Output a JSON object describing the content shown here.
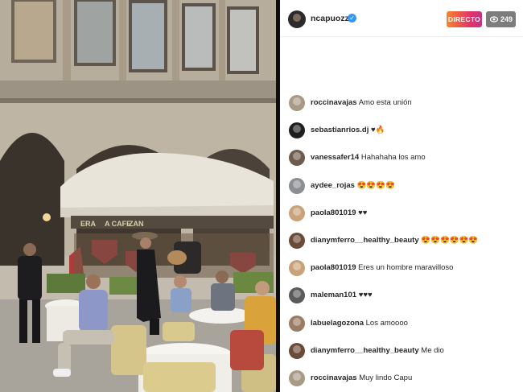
{
  "live": {
    "host": "ncapuozzo",
    "verified": true,
    "live_label": "DIRECTO",
    "viewer_icon": "eye-icon",
    "viewer_count": "249"
  },
  "comments": [
    {
      "user": "roccinavajas",
      "text": "Amo esta unión",
      "avatar_color": "#a99a86"
    },
    {
      "user": "sebastianrios.dj",
      "text": "♥🔥",
      "avatar_color": "#1f1f1f"
    },
    {
      "user": "vanessafer14",
      "text": "Hahahaha los amo",
      "avatar_color": "#6d5b4e"
    },
    {
      "user": "aydee_rojas",
      "text": "😍😍😍😍",
      "avatar_color": "#8b8f94"
    },
    {
      "user": "paola801019",
      "text": "♥♥",
      "avatar_color": "#c9a27c"
    },
    {
      "user": "dianymferro__healthy_beauty",
      "text": "😍😍😍😍😍😍",
      "avatar_color": "#6b4a3a"
    },
    {
      "user": "paola801019",
      "text": "Eres un hombre maravilloso",
      "avatar_color": "#c9a27c"
    },
    {
      "user": "maleman101",
      "text": "♥♥♥",
      "avatar_color": "#5a5a5a"
    },
    {
      "user": "labuelagozona",
      "text": "Los amoooo",
      "avatar_color": "#9a7b63"
    },
    {
      "user": "dianymferro__healthy_beauty",
      "text": "Me dio",
      "avatar_color": "#6b4a3a"
    },
    {
      "user": "roccinavajas",
      "text": "Muy lindo Capu",
      "avatar_color": "#a99a86"
    }
  ],
  "video": {
    "awning_signs": [
      "ERA",
      "A CAFE",
      "ZAN"
    ]
  }
}
